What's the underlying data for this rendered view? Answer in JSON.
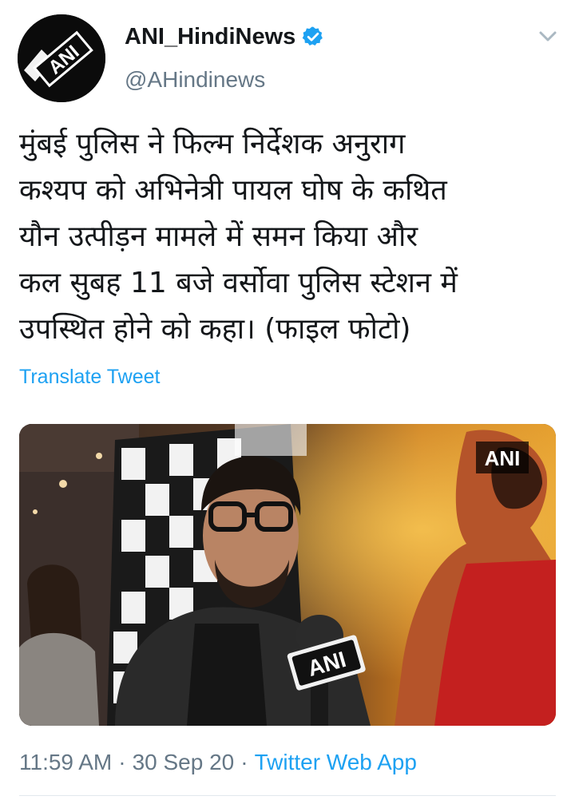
{
  "author": {
    "display_name": "ANI_HindiNews",
    "handle": "@AHindinews",
    "avatar_text": "ANI",
    "verified": true
  },
  "tweet": {
    "lines": [
      "मुंबई पुलिस ने फिल्म निर्देशक अनुराग",
      "कश्यप को अभिनेत्री पायल घोष के कथित",
      "यौन उत्पीड़न मामले में समन किया और",
      "कल सुबह 11 बजे वर्सोवा पुलिस स्टेशन में",
      "उपस्थित होने को कहा। (फाइल फोटो)"
    ],
    "translate_label": "Translate Tweet"
  },
  "media": {
    "watermark": "ANI",
    "mic_label": "ANI"
  },
  "meta": {
    "time": "11:59 AM",
    "date": "30 Sep 20",
    "source": "Twitter Web App"
  },
  "colors": {
    "link": "#1da1f2",
    "secondary_text": "#657786",
    "primary_text": "#14171a"
  }
}
